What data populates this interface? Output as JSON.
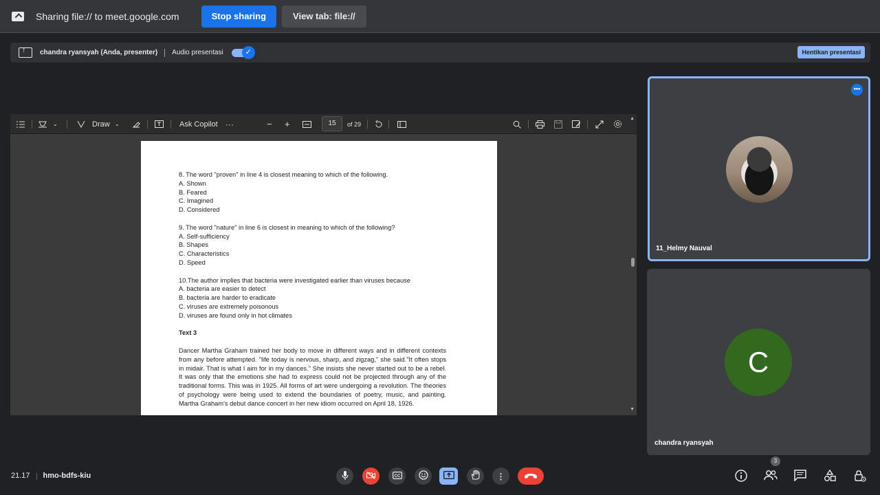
{
  "share_bar": {
    "text": "Sharing file:// to meet.google.com",
    "stop_label": "Stop sharing",
    "view_label": "View tab: file://"
  },
  "present_bar": {
    "presenter": "chandra ryansyah (Anda, presenter)",
    "audio_label": "Audio presentasi",
    "audio_on": true,
    "end_label": "Hentikan presentasi"
  },
  "pdf": {
    "toolbar": {
      "draw_label": "Draw",
      "copilot_label": "Ask Copilot",
      "page_current": "15",
      "page_total": "of 29"
    },
    "q8": [
      "8. The word \"proven\" in line 4 is closest meaning to which of the following.",
      "A. Shown",
      "B. Feared",
      "C. Imagined",
      "D. Considered"
    ],
    "q9": [
      "9. The word  \"nature\" in line 6 is closest in meaning to which of the following?",
      "A. Self-sufficiency",
      "B. Shapes",
      "C. Characteristics",
      "D. Speed"
    ],
    "q10": [
      "10.The author implies that bacteria were investigated earlier than viruses because",
      "A. bacteria are easier to detect",
      "B. bacteria are harder to eradicate",
      "C. viruses are extremely poisonous",
      "D. viruses are found only in hot climates"
    ],
    "heading": "Text 3",
    "paragraph": "Dancer Martha Graham trained her body to move in different ways and in different contexts from any before attempted. \"life today is nervous, sharp, and zigzag,\" she said.\"It often stops in midair. That is what I aim for in my dances.\" She insists she never started out to be a rebel. It was only that the emotions she had to express could not be projected through any of the traditional forms. This was in 1925. All forms of art were undergoing a revolution. The theories of psychology were being used to extend the boundaries of poetry, music, and painting. Martha Graham's debut dance concert in her new idiom occurred on April 18, 1926."
  },
  "participants": [
    {
      "name": "11_Helmy Nauval",
      "more": "•••"
    },
    {
      "name": "chandra ryansyah",
      "initial": "C"
    }
  ],
  "bottom": {
    "time": "21.17",
    "meeting_code": "hmo-bdfs-kiu",
    "people_count": "3"
  },
  "colors": {
    "accent": "#1a73e8",
    "light_accent": "#8ab4f8",
    "danger": "#ea4335",
    "avatar_green": "#33691e"
  }
}
